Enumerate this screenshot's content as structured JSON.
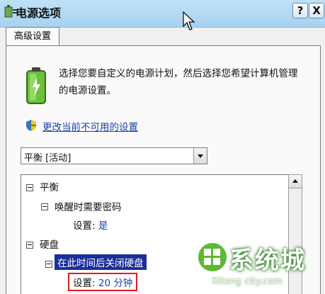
{
  "window": {
    "title": "电源选项",
    "help_label": "?",
    "close_label": "X"
  },
  "tabs": [
    {
      "label": "高级设置"
    }
  ],
  "main": {
    "description": "选择您要自定义的电源计划，然后选择您希望计算机管理的电源设置。",
    "change_link": "更改当前不可用的设置",
    "plan_select": {
      "value": "平衡 [活动]"
    }
  },
  "tree": {
    "balanced": {
      "label": "平衡",
      "toggle": "⊟"
    },
    "password_on_wake": {
      "label": "唤醒时需要密码"
    },
    "password_setting": {
      "label": "设置:",
      "value": "是"
    },
    "hard_disk": {
      "label": "硬盘"
    },
    "turn_off_disk": {
      "label": "在此时间后关闭硬盘"
    },
    "disk_setting": {
      "label": "设置:",
      "value": "20 分钟"
    }
  },
  "watermark": {
    "text": "系统城",
    "subtext": "Xitong city.com"
  },
  "colors": {
    "selection": "#1a2f9a",
    "link": "#1a3fa8",
    "highlight_box": "#e01b1b"
  }
}
